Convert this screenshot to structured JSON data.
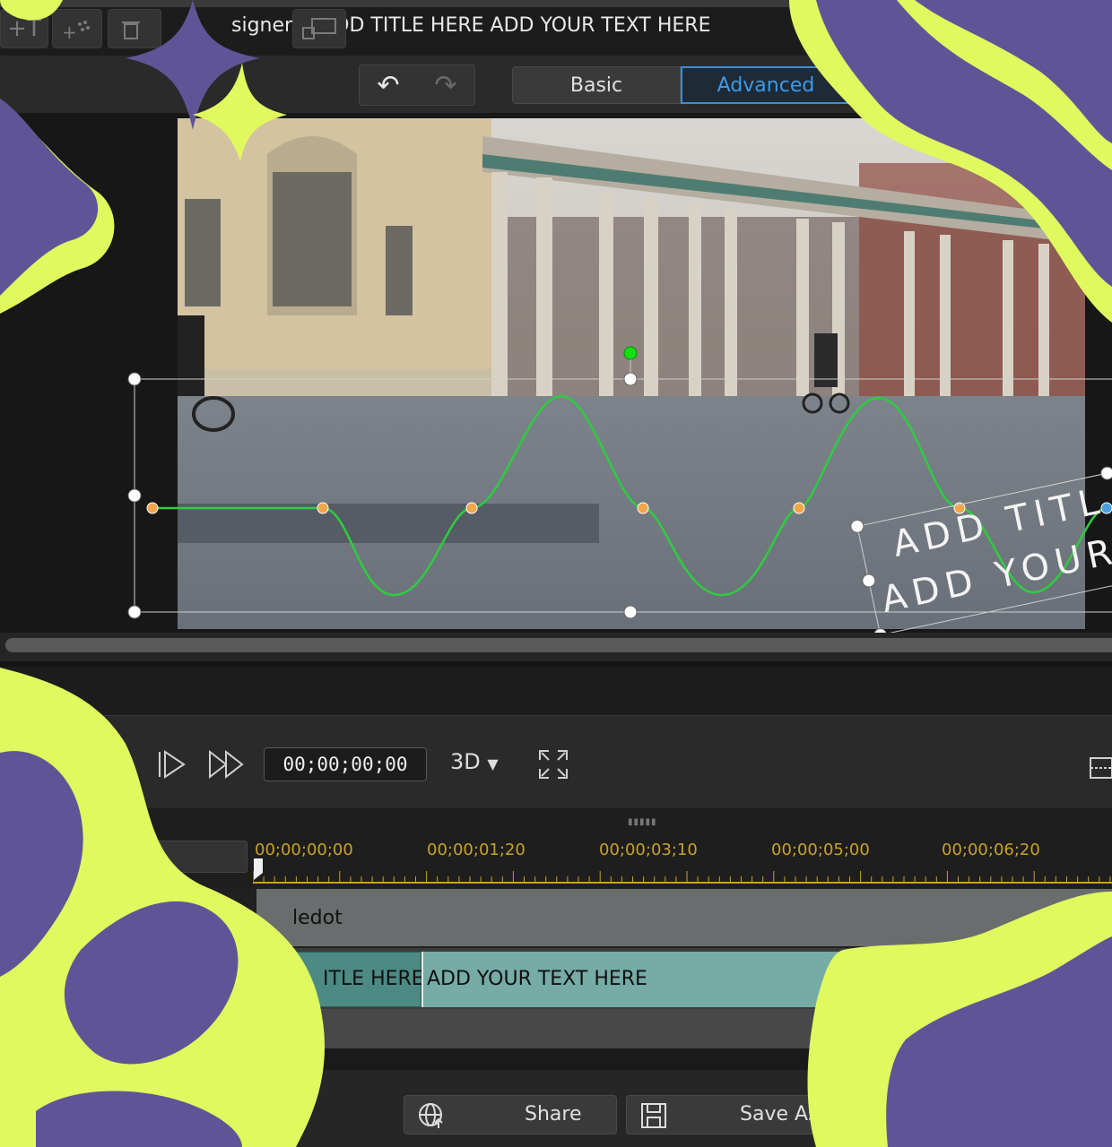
{
  "window": {
    "title_partial": "signer",
    "separator": "|",
    "document_title": "ADD TITLE HERE ADD YOUR TEXT HERE"
  },
  "toolbar": {
    "mode_basic": "Basic",
    "mode_advanced": "Advanced",
    "active_mode": "Advanced",
    "tool_text_glyph": "+T",
    "undo_glyph": "↶",
    "redo_glyph": "↷"
  },
  "preview": {
    "overlay_text_line1": "ADD TITL",
    "overlay_text_line2": "ADD YOUR"
  },
  "playback": {
    "timecode": "00;00;00;00",
    "mode_3d": "3D",
    "mode_3d_arrow": "▼"
  },
  "timeline": {
    "grip": "▮▮▮▮▮",
    "ruler_labels": [
      "00;00;00;00",
      "00;00;01;20",
      "00;00;03;10",
      "00;00;05;00",
      "00;00;06;20"
    ],
    "track1_label": "ledot",
    "clip_a_text": "ITLE HERE",
    "clip_b_text": "ADD YOUR TEXT HERE"
  },
  "footer": {
    "share_label": "Share",
    "save_as_label": "Save As"
  },
  "colors": {
    "accent_blue": "#3d8fd6",
    "path_green": "#2ecc40",
    "keyframe_orange": "#f2a54a",
    "ruler_gold": "#c9a227",
    "decor_purple": "#5f5596",
    "decor_lime": "#e0f95f"
  },
  "icons": [
    "logo-icon",
    "add-text-icon",
    "add-particle-icon",
    "delete-icon",
    "undo-icon",
    "redo-icon",
    "step-forward-icon",
    "fast-forward-icon",
    "fullscreen-icon",
    "share-globe-icon",
    "save-disk-icon"
  ]
}
